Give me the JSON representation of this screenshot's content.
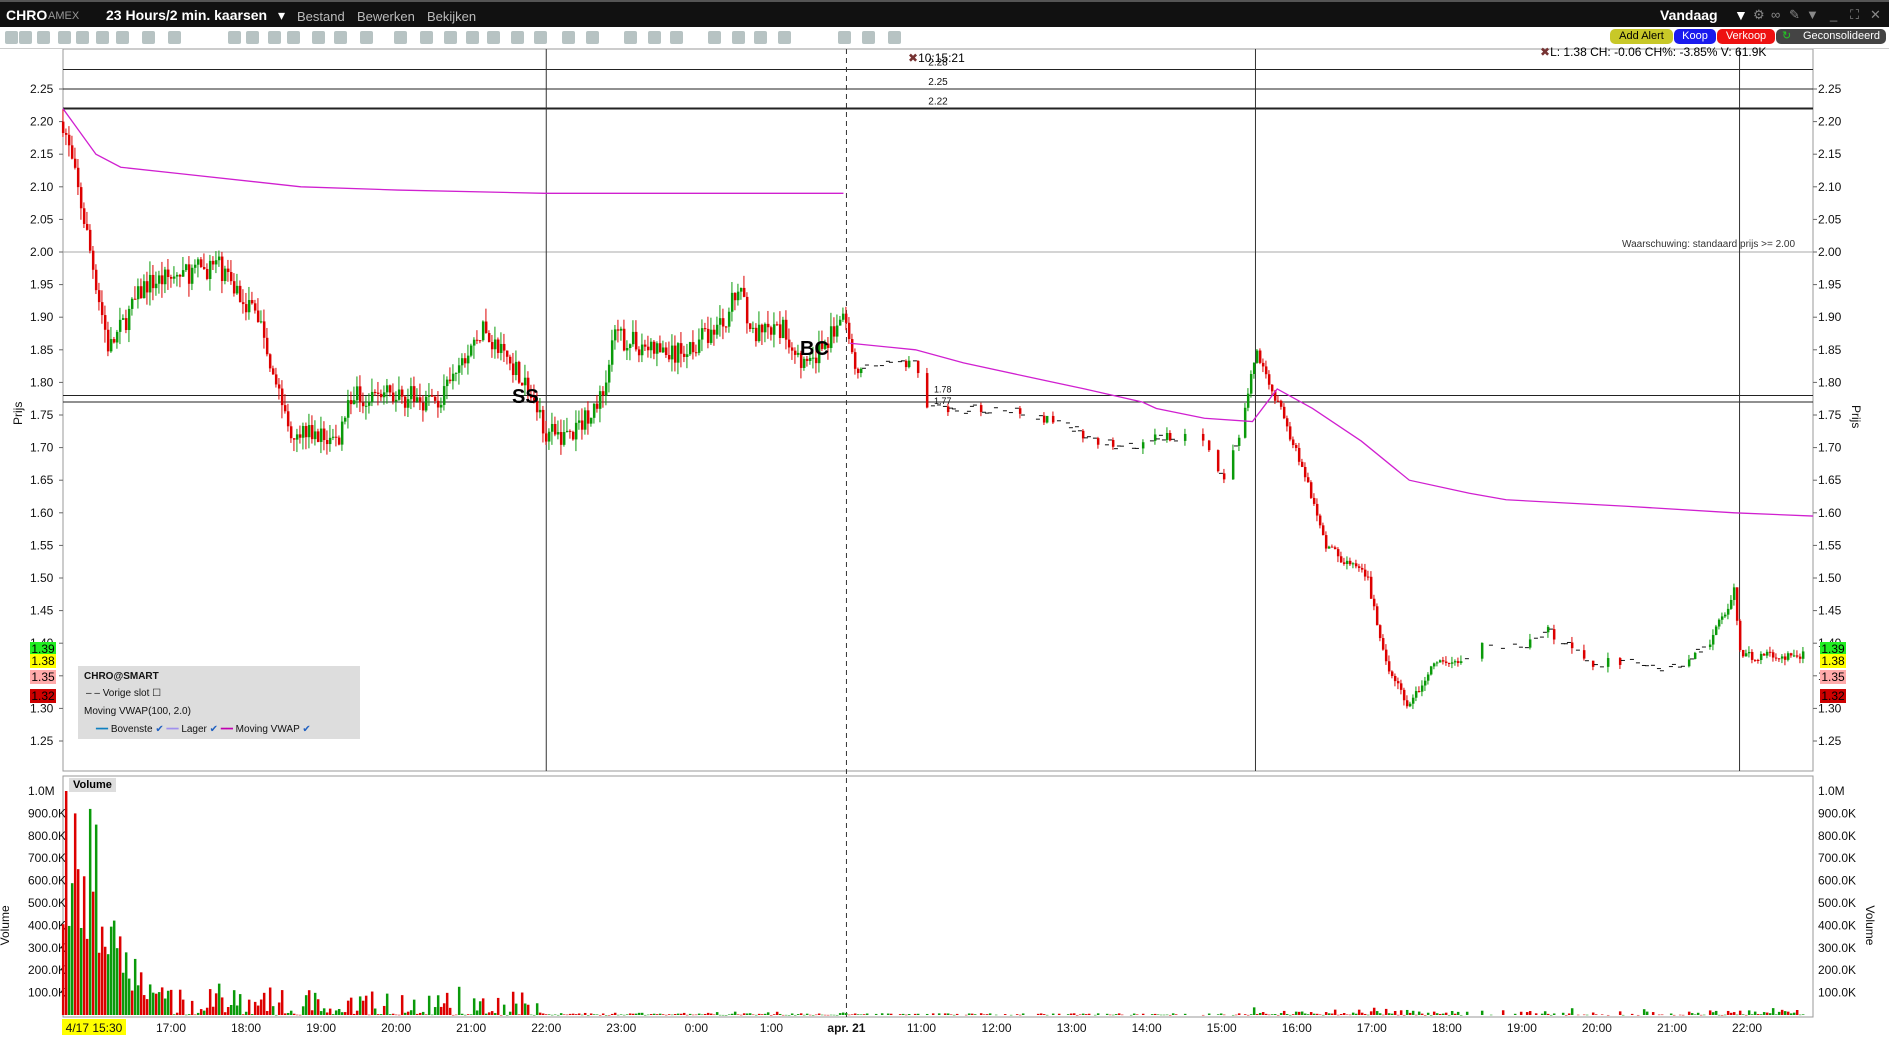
{
  "title": {
    "symbol": "CHRO",
    "exchange": "AMEX",
    "timeframe": "23 Hours/2 min. kaarsen",
    "menu": [
      "Bestand",
      "Bewerken",
      "Bekijken"
    ],
    "period": "Vandaag"
  },
  "buttons": {
    "alert": "Add Alert",
    "buy": "Koop",
    "sell": "Verkoop",
    "consolidated": "Geconsolideerd"
  },
  "header": {
    "info": "L: 1.38 CH: -0.06 CH%: -3.85% V: 61.9K",
    "crosshair_time": "10:15:21",
    "warning": "Waarschuwing: standaard prijs >= 2.00"
  },
  "legend": {
    "title": "CHRO@SMART",
    "prev_close": "Vorige slot",
    "indicator": "Moving VWAP(100, 2.0)",
    "upper": "Bovenste",
    "lower": "Lager",
    "vwap": "Moving VWAP",
    "volume": "Volume"
  },
  "markers": {
    "ss": "SS",
    "bc": "BC"
  },
  "colors": {
    "up": "#0a9a0a",
    "down": "#dd0000",
    "vwap": "#d020d0",
    "alert": "#bbbb22",
    "buy": "#1010ee",
    "sell": "#ee1111"
  },
  "chart_data": {
    "type": "candlestick",
    "price_axis": {
      "label": "Prijs",
      "min": 1.25,
      "max": 2.25,
      "ticks": [
        "2.25",
        "2.20",
        "2.15",
        "2.10",
        "2.05",
        "2.00",
        "1.95",
        "1.90",
        "1.85",
        "1.80",
        "1.75",
        "1.70",
        "1.65",
        "1.60",
        "1.55",
        "1.50",
        "1.45",
        "1.40",
        "1.35",
        "1.30",
        "1.25"
      ]
    },
    "volume_axis": {
      "label": "Volume",
      "ticks": [
        "1.0M",
        "900.0K",
        "800.0K",
        "700.0K",
        "600.0K",
        "500.0K",
        "400.0K",
        "300.0K",
        "200.0K",
        "100.0K"
      ]
    },
    "time_ticks": [
      "17:00",
      "18:00",
      "19:00",
      "20:00",
      "21:00",
      "22:00",
      "23:00",
      "0:00",
      "1:00",
      "apr. 21",
      "11:00",
      "12:00",
      "13:00",
      "14:00",
      "15:00",
      "16:00",
      "17:00",
      "18:00",
      "19:00",
      "20:00",
      "21:00",
      "22:00"
    ],
    "start_label": "4/17 15:30",
    "level_lines": [
      {
        "label": "2.28",
        "price": 2.28
      },
      {
        "label": "2.25",
        "price": 2.25
      },
      {
        "label": "2.22",
        "price": 2.22
      },
      {
        "label": "1.78",
        "price": 1.78
      },
      {
        "label": "1.77",
        "price": 1.77
      }
    ],
    "price_tags": [
      {
        "label": "1.39",
        "bg": "#22ee22"
      },
      {
        "label": "1.38",
        "bg": "#ffff00"
      },
      {
        "label": "1.35",
        "bg": "#ffaaaa"
      },
      {
        "label": "1.32",
        "bg": "#cc0000"
      }
    ],
    "price_path": [
      [
        -1.44,
        2.2
      ],
      [
        -1.16,
        2.05
      ],
      [
        -0.83,
        1.85
      ],
      [
        -0.35,
        1.95
      ],
      [
        0.61,
        1.98
      ],
      [
        1.17,
        1.9
      ],
      [
        1.57,
        1.73
      ],
      [
        2.22,
        1.71
      ],
      [
        2.38,
        1.78
      ],
      [
        3.02,
        1.78
      ],
      [
        3.58,
        1.77
      ],
      [
        4.14,
        1.88
      ],
      [
        4.62,
        1.82
      ],
      [
        5.02,
        1.72
      ],
      [
        5.35,
        1.72
      ],
      [
        5.75,
        1.78
      ],
      [
        5.91,
        1.87
      ],
      [
        6.71,
        1.84
      ],
      [
        7.35,
        1.89
      ],
      [
        7.59,
        1.95
      ],
      [
        7.75,
        1.87
      ],
      [
        8.15,
        1.88
      ],
      [
        8.48,
        1.82
      ],
      [
        8.96,
        1.9
      ],
      [
        9.12,
        1.82
      ],
      [
        9.92,
        1.83
      ],
      [
        10.08,
        1.76
      ],
      [
        11.04,
        1.76
      ],
      [
        11.85,
        1.74
      ],
      [
        12.33,
        1.71
      ],
      [
        12.94,
        1.7
      ],
      [
        13.13,
        1.72
      ],
      [
        13.77,
        1.71
      ],
      [
        14.01,
        1.65
      ],
      [
        14.25,
        1.72
      ],
      [
        14.46,
        1.85
      ],
      [
        14.74,
        1.77
      ],
      [
        15.14,
        1.65
      ],
      [
        15.38,
        1.55
      ],
      [
        15.94,
        1.5
      ],
      [
        16.18,
        1.37
      ],
      [
        16.5,
        1.3
      ],
      [
        16.82,
        1.37
      ],
      [
        17.14,
        1.37
      ],
      [
        17.54,
        1.4
      ],
      [
        17.95,
        1.39
      ],
      [
        18.35,
        1.42
      ],
      [
        18.91,
        1.37
      ],
      [
        19.55,
        1.37
      ],
      [
        20.03,
        1.36
      ],
      [
        20.51,
        1.4
      ],
      [
        20.83,
        1.48
      ],
      [
        20.91,
        1.38
      ],
      [
        21.75,
        1.38
      ]
    ],
    "vwap": [
      [
        [
          -1.44,
          2.22
        ],
        [
          -1.0,
          2.15
        ],
        [
          -0.67,
          2.13
        ],
        [
          0.13,
          2.12
        ],
        [
          1.73,
          2.1
        ],
        [
          3.02,
          2.095
        ],
        [
          4.98,
          2.09
        ],
        [
          8.96,
          2.09
        ]
      ],
      [
        [
          9.05,
          1.86
        ],
        [
          9.92,
          1.85
        ],
        [
          10.56,
          1.83
        ],
        [
          11.36,
          1.81
        ],
        [
          12.17,
          1.79
        ],
        [
          12.94,
          1.77
        ],
        [
          13.13,
          1.76
        ],
        [
          13.77,
          1.745
        ],
        [
          14.41,
          1.74
        ],
        [
          14.74,
          1.79
        ],
        [
          15.21,
          1.76
        ],
        [
          15.86,
          1.71
        ],
        [
          16.5,
          1.65
        ],
        [
          17.3,
          1.63
        ],
        [
          17.79,
          1.62
        ],
        [
          19.39,
          1.61
        ],
        [
          20.83,
          1.6
        ],
        [
          21.88,
          1.595
        ]
      ]
    ],
    "volume_peaks": [
      [
        -1.42,
        1000000
      ],
      [
        -1.3,
        900000
      ],
      [
        -1.1,
        920000
      ],
      [
        -1.0,
        850000
      ]
    ]
  }
}
